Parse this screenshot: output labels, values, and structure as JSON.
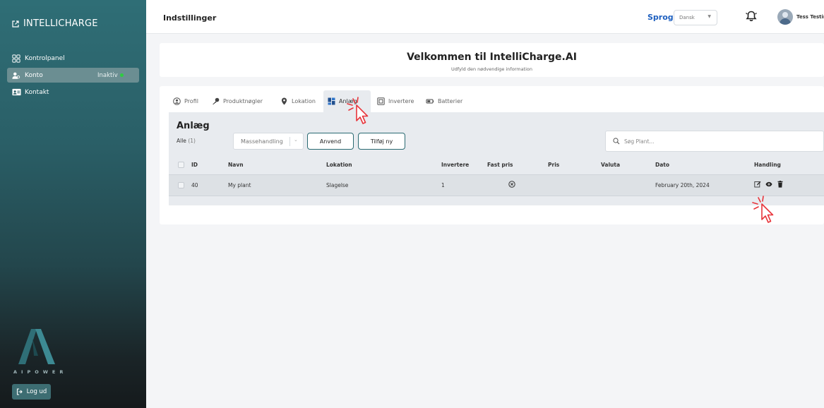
{
  "app": {
    "brand": "INTELLICHARGE"
  },
  "sidebar": {
    "items": [
      {
        "label": "Kontrolpanel",
        "icon": "dashboard-icon"
      },
      {
        "label": "Konto",
        "icon": "account-icon",
        "status": "Inaktiv",
        "active": true
      },
      {
        "label": "Kontakt",
        "icon": "contact-card-icon"
      }
    ],
    "logo_text": "AIPOWER",
    "logout_label": "Log ud"
  },
  "header": {
    "title": "Indstillinger",
    "language_label": "Sprog",
    "language_value": "Dansk",
    "user_name": "Tess Testing"
  },
  "welcome": {
    "title": "Velkommen til IntelliCharge.AI",
    "subtitle": "Udfyld den nødvendige information"
  },
  "tabs": [
    {
      "label": "Profil",
      "icon": "user-circle-icon"
    },
    {
      "label": "Produktnøgler",
      "icon": "key-icon"
    },
    {
      "label": "Lokation",
      "icon": "location-pin-icon"
    },
    {
      "label": "Anlæg",
      "icon": "grid-icon",
      "active": true
    },
    {
      "label": "Invertere",
      "icon": "inverter-icon"
    },
    {
      "label": "Batterier",
      "icon": "battery-icon"
    }
  ],
  "plants": {
    "title": "Anlæg",
    "count_label": "Alle",
    "count": "(1)",
    "bulk_action": "Massehandling",
    "apply_label": "Anvend",
    "add_label": "Tilføj ny",
    "search_placeholder": "Søg Plant...",
    "columns": [
      "ID",
      "Navn",
      "Lokation",
      "Invertere",
      "Fast pris",
      "Pris",
      "Valuta",
      "Dato",
      "Handling"
    ],
    "rows": [
      {
        "id": "40",
        "name": "My plant",
        "location": "Slagelse",
        "inverters": "1",
        "fixed_price": "cancel-circle-icon",
        "price": "",
        "currency": "",
        "date": "February 20th, 2024"
      }
    ]
  },
  "colors": {
    "accent": "#1d5fbf",
    "brand_teal": "#2f6e76",
    "cursor_red": "#e8343a",
    "active_dot": "#2ecc40"
  }
}
